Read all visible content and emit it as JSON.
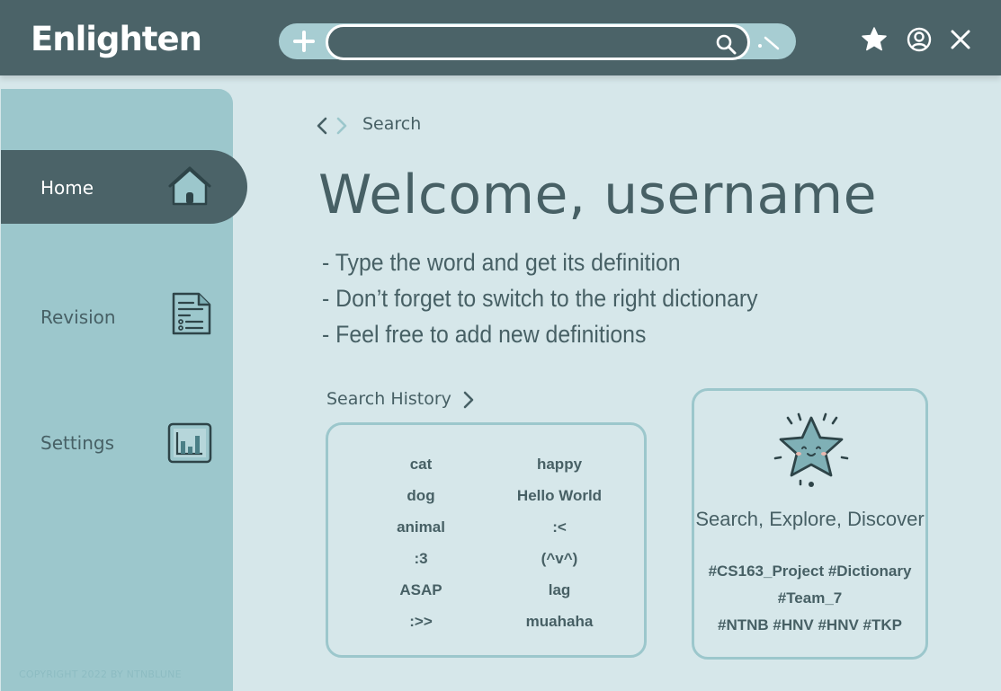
{
  "app": {
    "name": "Enlighten"
  },
  "header": {
    "search": {
      "value": "",
      "placeholder": ""
    },
    "icons": [
      "plus-icon",
      "search-icon",
      "pen-icon",
      "star-icon",
      "user-icon",
      "close-icon"
    ]
  },
  "sidebar": {
    "items": [
      {
        "label": "Home",
        "icon": "home-icon",
        "active": true
      },
      {
        "label": "Revision",
        "icon": "document-icon",
        "active": false
      },
      {
        "label": "Settings",
        "icon": "chart-icon",
        "active": false
      }
    ],
    "copyright": "COPYRIGHT 2022 BY NTNBLUNE"
  },
  "main": {
    "breadcrumb": "Search",
    "welcome": "Welcome, username",
    "tips": [
      "- Type the word and get its definition",
      "- Don’t forget to switch to the right dictionary",
      "- Feel free to add new definitions"
    ],
    "history_title": "Search History",
    "history_left": [
      "cat",
      "dog",
      "animal",
      ":3",
      "ASAP",
      ":>>"
    ],
    "history_right": [
      "happy",
      "Hello World",
      ":<",
      "(^v^)",
      "lag",
      "muahaha"
    ],
    "promo": {
      "tagline": "Search, Explore, Discover",
      "hashtags": [
        "#CS163_Project #Dictionary",
        "#Team_7",
        "#NTNB #HNV #HNV #TKP"
      ]
    }
  },
  "colors": {
    "header_bg": "#4b6368",
    "sidebar_bg": "#9cc7cc",
    "page_bg": "#d6e7ea",
    "text": "#476065"
  }
}
